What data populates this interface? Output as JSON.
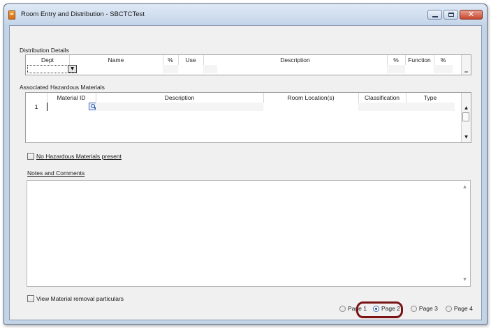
{
  "window": {
    "title": "Room Entry and Distribution - SBCTCTest",
    "close_glyph": "✕"
  },
  "distribution": {
    "label": "Distribution Details",
    "columns": [
      "Dept",
      "Name",
      "%",
      "Use",
      "Description",
      "%",
      "Function",
      "%"
    ]
  },
  "hazardous": {
    "label": "Associated Hazardous Materials",
    "columns": [
      "Material ID",
      "Description",
      "Room Location(s)",
      "Classification",
      "Type"
    ],
    "rows": [
      {
        "num": "1",
        "material_id": ""
      }
    ]
  },
  "no_hazardous_checkbox": {
    "label": "No Hazardous Materials present",
    "checked": false
  },
  "notes": {
    "label": "Notes and Comments",
    "value": ""
  },
  "view_material_checkbox": {
    "label": "View Material removal particulars",
    "checked": false
  },
  "pages": {
    "options": [
      "Page 1",
      "Page 2",
      "Page 3",
      "Page 4"
    ],
    "selected": "Page 2"
  }
}
